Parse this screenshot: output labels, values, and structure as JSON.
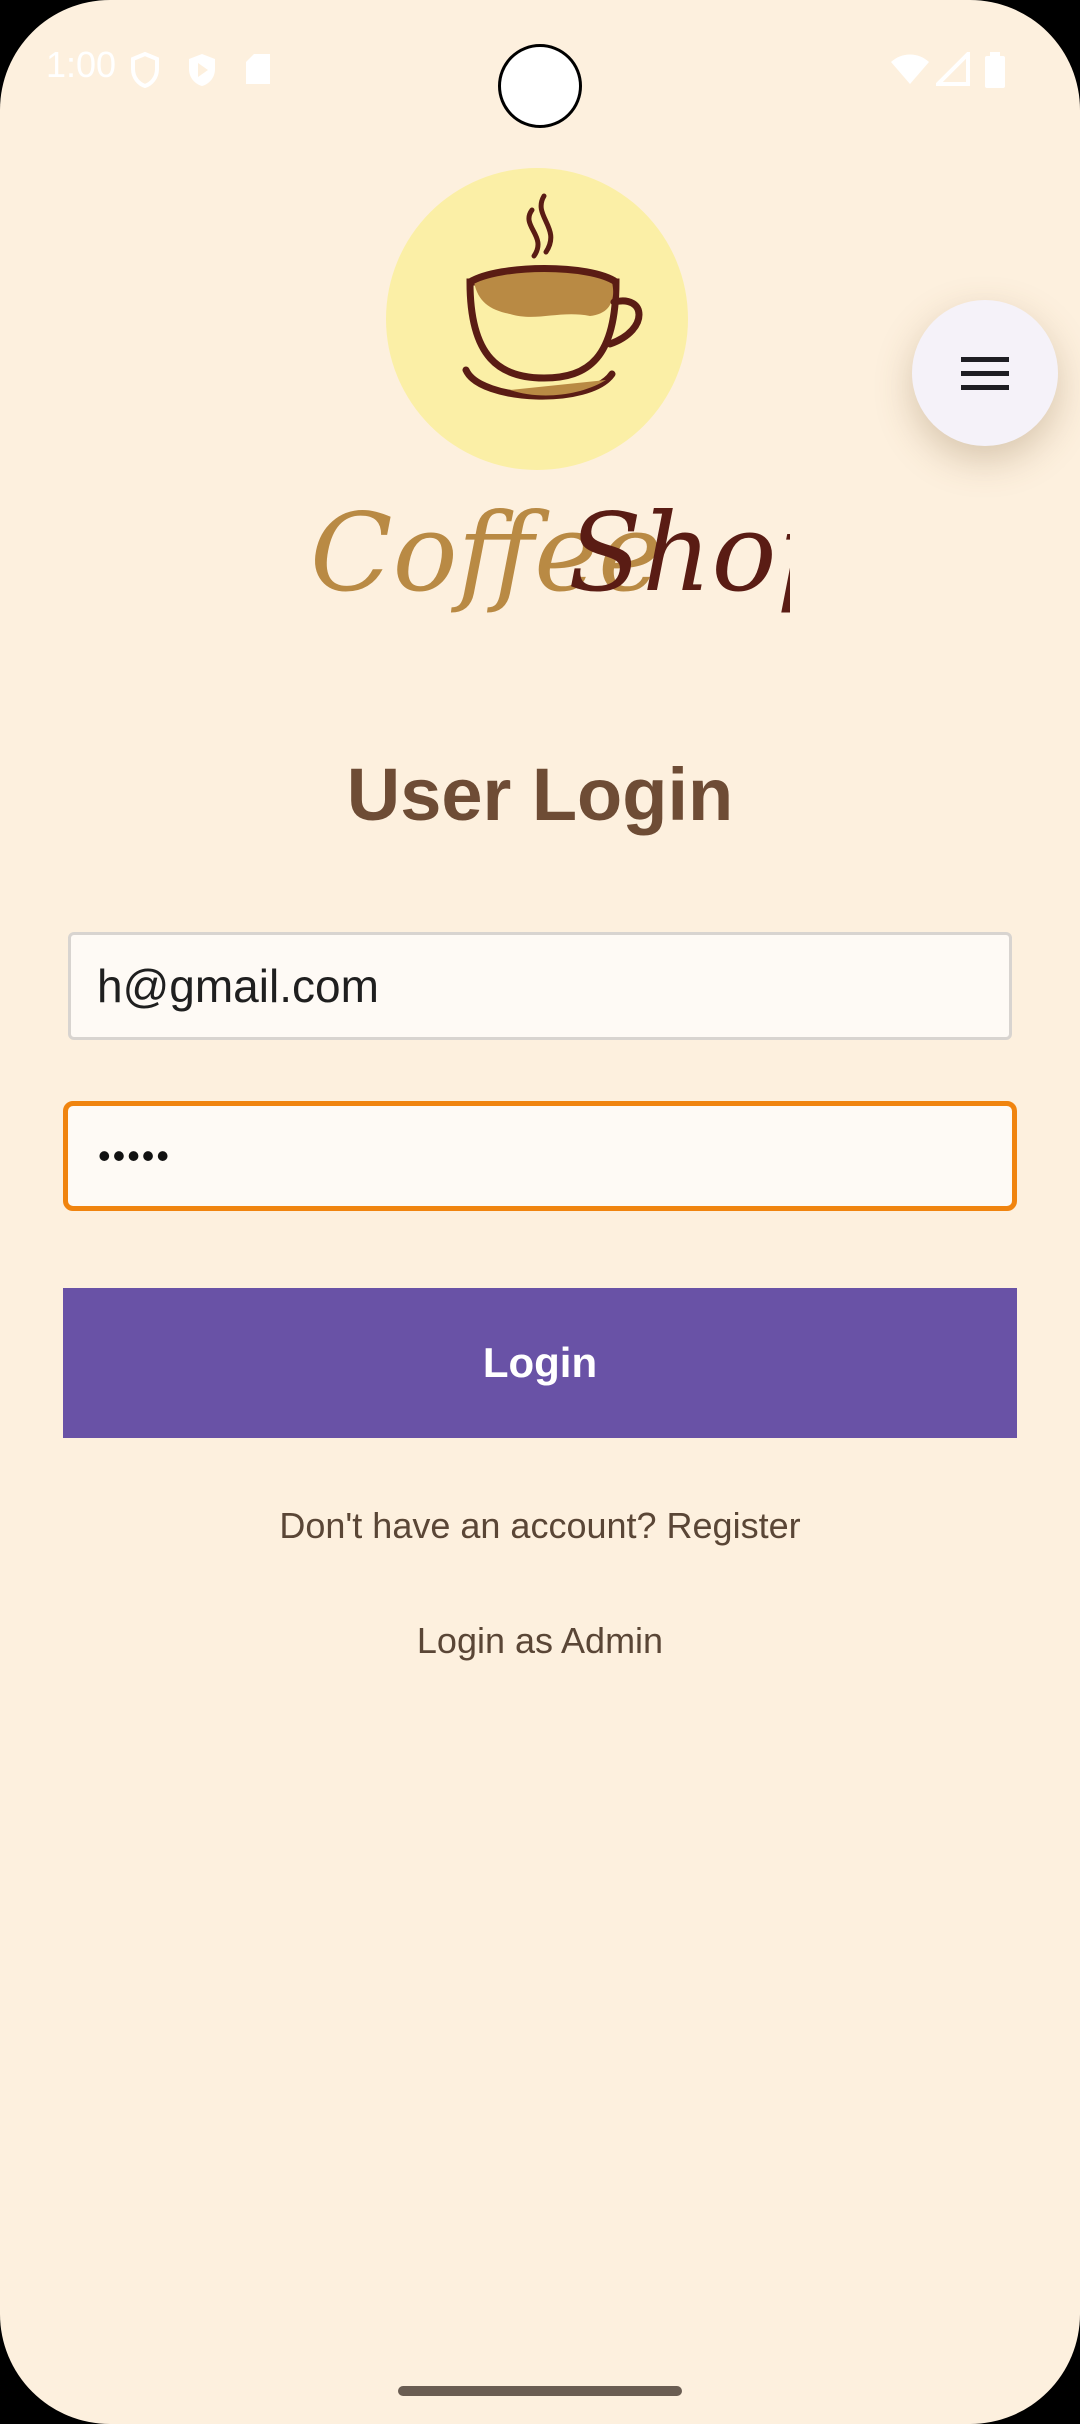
{
  "status_bar": {
    "time": "1:00",
    "icons": [
      "shield-icon",
      "play-protect-icon",
      "sd-card-icon",
      "wifi-icon",
      "signal-icon",
      "battery-icon"
    ]
  },
  "fab": {
    "icon": "menu-icon"
  },
  "logo": {
    "brand_part_1": "Coffee",
    "brand_part_2": "Shop",
    "icon": "coffee-cup-icon",
    "circle_color": "#fbefa6",
    "coffee_part_1_color": "#b98a44",
    "coffee_part_2_color": "#5a1c14"
  },
  "form": {
    "title": "User Login",
    "email_value": "h@gmail.com",
    "password_value": "•••••",
    "login_label": "Login",
    "register_link": "Don't have an account? Register",
    "admin_link": "Login as Admin"
  },
  "colors": {
    "background": "#fdf0de",
    "title": "#6e4c35",
    "accent_button": "#6952a6",
    "focus_border": "#f0840f"
  }
}
